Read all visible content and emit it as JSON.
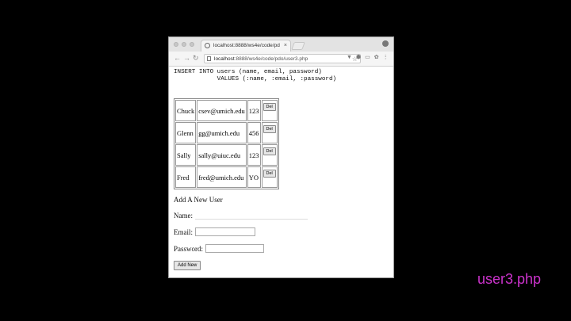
{
  "browser": {
    "tab_title": "localhost:8888/ws4e/code/pd",
    "tab_close": "×",
    "url_host": "localhost",
    "url_rest": ":8888/ws4e/code/pdo/user3.php",
    "nav": {
      "back": "←",
      "forward": "→",
      "reload": "↻"
    },
    "star": "☆",
    "toolbar_icons": [
      "▼",
      "⬢",
      "▭",
      "✿",
      "⋮"
    ]
  },
  "sql": {
    "line1": "INSERT INTO users (name, email, password)",
    "line2": "            VALUES (:name, :email, :password)"
  },
  "users": [
    {
      "name": "Chuck",
      "email": "csev@umich.edu",
      "password": "123",
      "delete_label": "Del"
    },
    {
      "name": "Glenn",
      "email": "gg@umich.edu",
      "password": "456",
      "delete_label": "Del"
    },
    {
      "name": "Sally",
      "email": "sally@uiuc.edu",
      "password": "123",
      "delete_label": "Del"
    },
    {
      "name": "Fred",
      "email": "fred@umich.edu",
      "password": "YO",
      "delete_label": "Del"
    }
  ],
  "form": {
    "heading": "Add A New User",
    "name_label": "Name:",
    "email_label": "Email:",
    "password_label": "Password:",
    "submit_label": "Add New"
  },
  "caption": "user3.php",
  "colors": {
    "caption": "#cc33cc",
    "background": "#000000"
  }
}
